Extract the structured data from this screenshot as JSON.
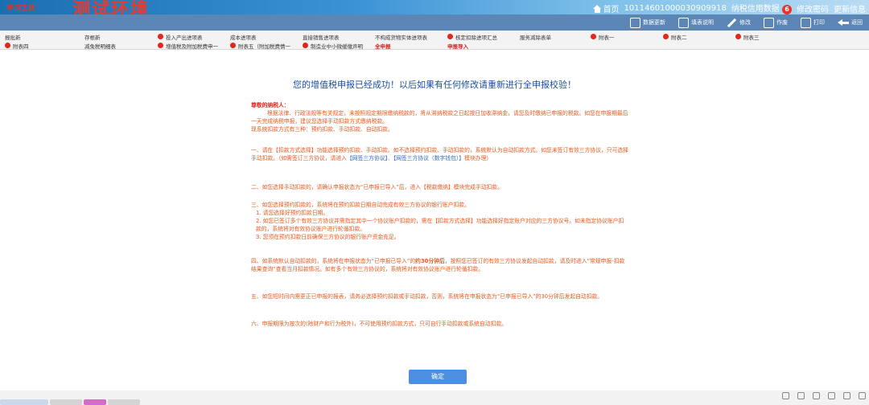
{
  "header": {
    "brand_small": "学习工具",
    "brand_big": "测试环境",
    "home": "首页",
    "taxpayer_id": "10114601000030909918",
    "user_name": "纳税信用数据",
    "badge": "6",
    "change_password": "修改密码",
    "update_info": "更新信息"
  },
  "toolbar": {
    "items": [
      {
        "label": "数据更新"
      },
      {
        "label": "填表说明"
      },
      {
        "label": "修改"
      },
      {
        "label": "作废"
      },
      {
        "label": "打印"
      },
      {
        "label": "返回"
      }
    ]
  },
  "tabs": [
    {
      "label": "报批新",
      "dot": false,
      "red": false
    },
    {
      "label": "存根新",
      "dot": false,
      "red": false
    },
    {
      "label": "投入产出进项表",
      "dot": true,
      "red": false
    },
    {
      "label": "成本进项表",
      "dot": false,
      "red": false
    },
    {
      "label": "直接销售进项表",
      "dot": false,
      "red": false
    },
    {
      "label": "不构成货物实体进项表",
      "dot": false,
      "red": false
    },
    {
      "label": "核定扣除进项汇总",
      "dot": true,
      "red": false
    },
    {
      "label": "服务减除表单",
      "dot": false,
      "red": false
    },
    {
      "label": "附表一",
      "dot": true,
      "red": false
    },
    {
      "label": "附表二",
      "dot": true,
      "red": false
    },
    {
      "label": "附表三",
      "dot": true,
      "red": false
    },
    {
      "label": "附表四",
      "dot": true,
      "red": false
    },
    {
      "label": "减免税明细表",
      "dot": false,
      "red": false
    },
    {
      "label": "增值税及附加税费申一",
      "dot": true,
      "red": false
    },
    {
      "label": "附表五（附加税费情一",
      "dot": true,
      "red": false
    },
    {
      "label": "制造业中小微缓缴声明",
      "dot": true,
      "red": false
    },
    {
      "label": "全申报",
      "dot": false,
      "red": true
    },
    {
      "label": "申报导入",
      "dot": false,
      "red": true
    }
  ],
  "main": {
    "title": "您的增值税申报已经成功！以后如果有任何修改请重新进行全申报校验！",
    "greeting": "尊敬的纳税人：",
    "p1": "根据法律、行政法规等有关规定，未按照规定期限缴纳税款的，将从滞纳税款之日起按日加收滞纳金，请您及时缴纳已申报的税款。如您在申报期最后一天完成纳税申报，建议您选择手动扣款方式缴纳税款。",
    "p1b": "现系统扣款方式有三种：预约扣款、手动扣款、自动扣款。",
    "p2": "一、请在【扣款方式选择】功能选择预约扣款、手动扣款。如不选择预约扣款、手动扣款的，系统默认为自动扣款方式。如您未签订有效三方协议，只可选择手动扣款。（如需签订三方协议，请进入",
    "p2_link1": "【网签三方协议】",
    "p2_mid": "、",
    "p2_link2": "【网签三方协议（数字钱包）】",
    "p2_end": "模块办理）",
    "p3": "二、如您选择手动扣款的，请确认申报状态为“已申报已导入”后，进入【税款缴纳】模块完成手动扣款。",
    "p4": "三、如您选择预约扣款的，系统将在预约扣款日期自动完成有效三方协议的银行账户扣款。",
    "p4_1": "1. 请您选择好预约扣款日期。",
    "p4_2": "2. 如您已签订多个有效三方协议并需指定其中一个协议账户扣款的，需在【扣款方式选择】功能选择好指定账户对应的三方协议号。如未指定协议账户扣款的，系统将对有效协议账户进行轮循扣款。",
    "p4_3": "3. 您须在预约扣款日前确保三方协议的银行账户资金充足。",
    "p5_a": "四、如系统默认自动扣款的，系统将在申报状态为“已申报已导入”的",
    "p5_bold": "约30分钟后",
    "p5_b": "，按照您已签订的有效三方协议发起自动扣款，请及时进入“常规申报-扣款结果查询”查看当月扣款情况。如有多个有效三方协议的，系统将对有效协议账户进行轮循扣款。",
    "p6": "五、如您短时间内需更正已申报的报表，请务必选择预约扣款或手动扣款，否则，系统将在申报状态为“已申报已导入”的30分钟后发起自动扣款。",
    "p7": "六、申报期限为按次的(除财产和行为税外)，不可使用预约扣款方式，只可自行手动扣款或系统自动扣款。",
    "confirm": "确定"
  }
}
